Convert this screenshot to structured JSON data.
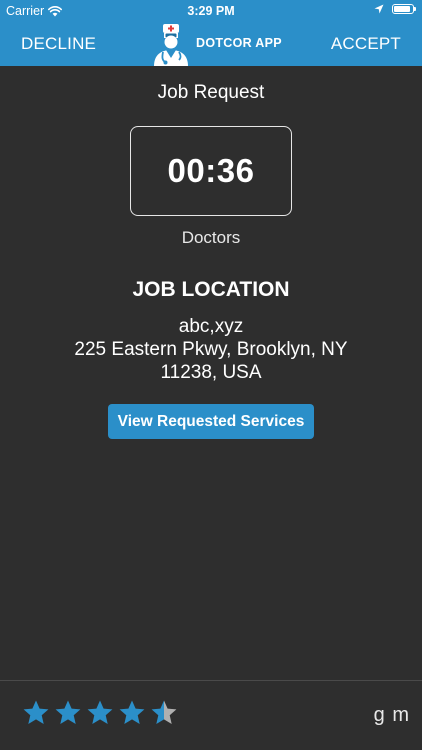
{
  "status_bar": {
    "carrier": "Carrier",
    "time": "3:29 PM",
    "battery_level": 0.9
  },
  "nav": {
    "decline_label": "DECLINE",
    "accept_label": "ACCEPT",
    "brand_name": "DOTCOR APP",
    "color": "#2b8fc9"
  },
  "job": {
    "title": "Job Request",
    "timer": "00:36",
    "category": "Doctors",
    "location_heading": "JOB LOCATION",
    "location_line1": "abc,xyz",
    "location_line2": "225 Eastern Pkwy,  Brooklyn,  NY",
    "location_line3": "11238,  USA",
    "services_button": "View Requested Services"
  },
  "footer": {
    "rating": 4.5,
    "rating_max": 5,
    "star_color": "#2b8fc9",
    "star_empty_color": "#b0b0b0",
    "user_name": "g m"
  },
  "icons": [
    "wifi-icon",
    "location-arrow-icon",
    "battery-icon",
    "doctor-logo-icon",
    "star-icon"
  ]
}
